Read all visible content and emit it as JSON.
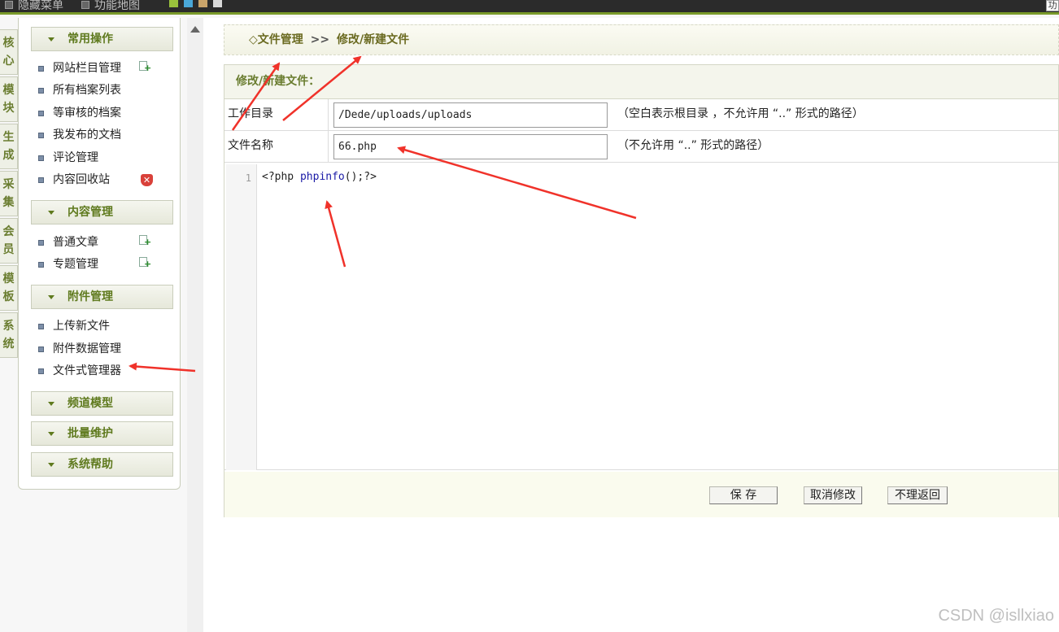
{
  "topbar": {
    "items": [
      "隐藏菜单",
      "功能地图"
    ],
    "right_box": "功"
  },
  "vtabs": [
    "核心",
    "模块",
    "生成",
    "采集",
    "会员",
    "模板",
    "系统"
  ],
  "sidebar": {
    "groups": [
      {
        "title": "常用操作",
        "items": [
          "网站栏目管理",
          "所有档案列表",
          "等审核的档案",
          "我发布的文档",
          "评论管理",
          "内容回收站"
        ]
      },
      {
        "title": "内容管理",
        "items": [
          "普通文章",
          "专题管理"
        ]
      },
      {
        "title": "附件管理",
        "items": [
          "上传新文件",
          "附件数据管理",
          "文件式管理器"
        ]
      },
      {
        "title": "频道模型"
      },
      {
        "title": "批量维护"
      },
      {
        "title": "系统帮助"
      }
    ]
  },
  "breadcrumb": {
    "root": "◇文件管理",
    "sep": ">>",
    "current": "修改/新建文件"
  },
  "panel": {
    "title": "修改/新建文件：",
    "fields": [
      {
        "label": "工作目录",
        "value": "/Dede/uploads/uploads",
        "hint": "（空白表示根目录 ，不允许用 “..” 形式的路径）"
      },
      {
        "label": "文件名称",
        "value": "66.php",
        "hint": "（不允许用 “..” 形式的路径）"
      }
    ],
    "editor": {
      "line_number": "1",
      "code_open": "<?php ",
      "code_fn": "phpinfo",
      "code_close": "();?>"
    },
    "buttons": [
      "保 存",
      "取消修改",
      "不理返回"
    ]
  },
  "watermark": "CSDN @isllxiao",
  "colors": {
    "accent": "#6a7d30",
    "annotation": "#f0322a"
  }
}
